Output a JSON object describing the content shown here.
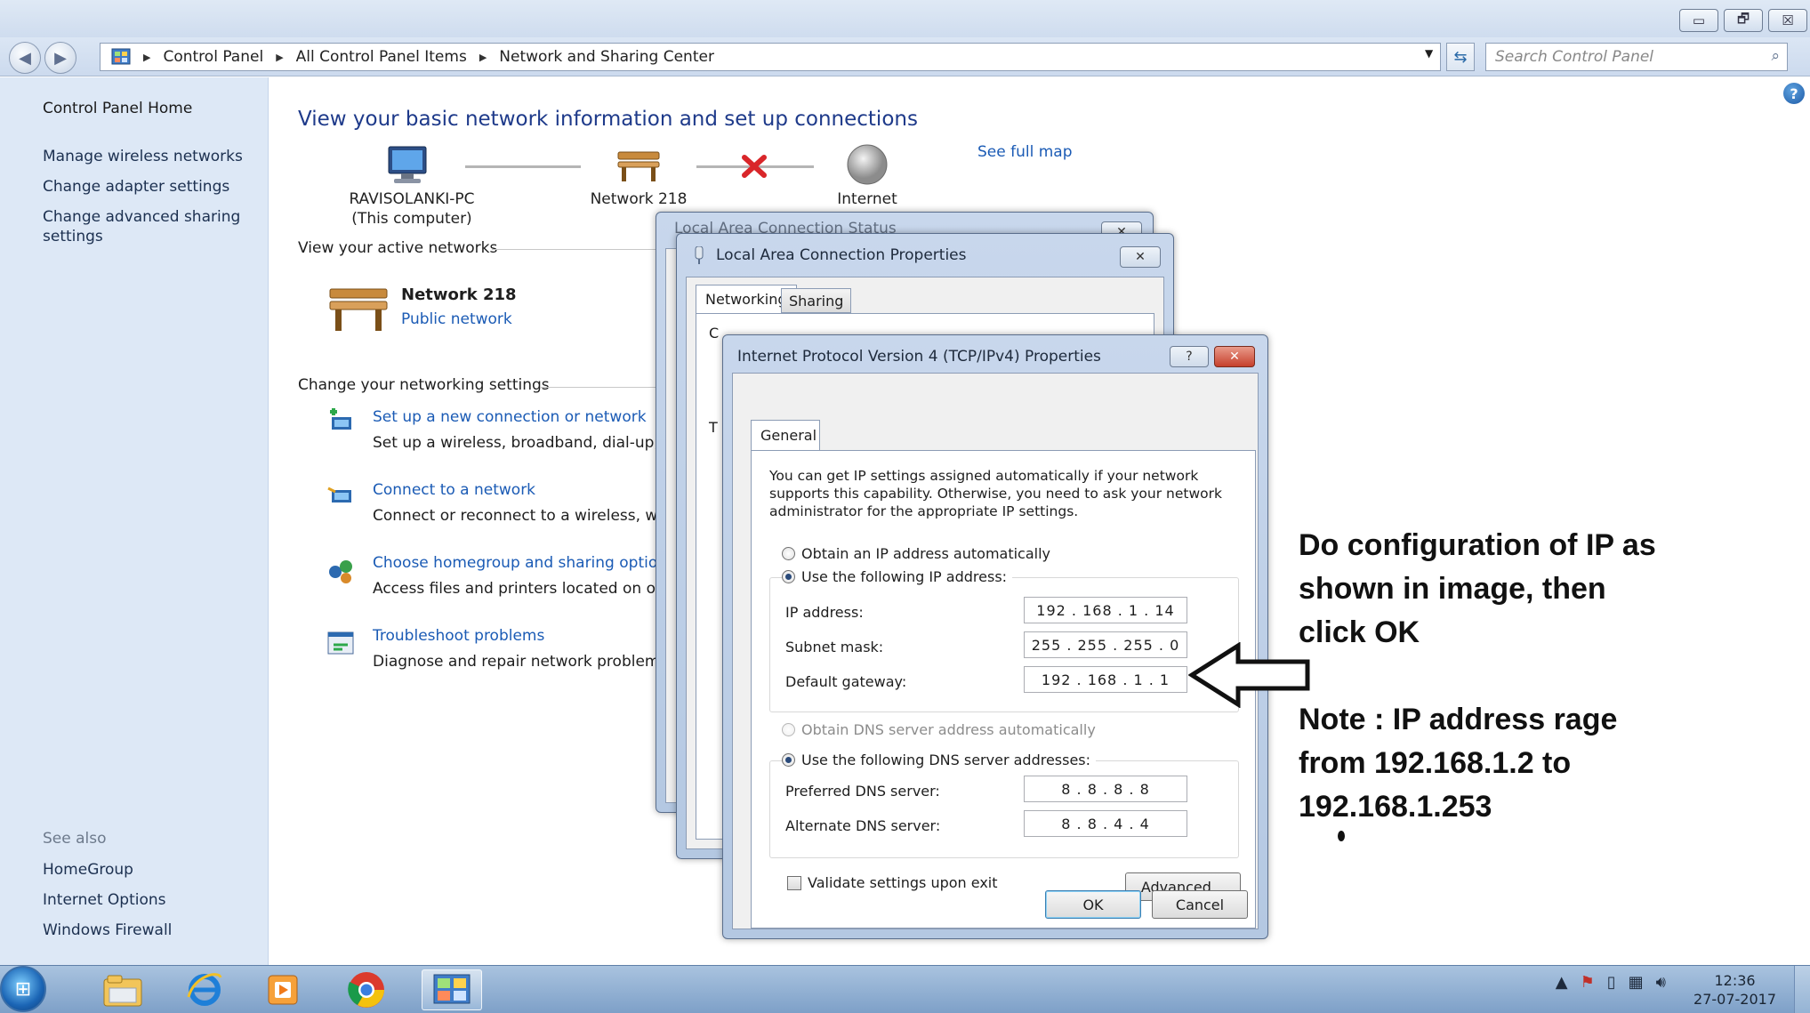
{
  "window": {
    "caption_buttons": [
      "▭",
      "🗗",
      "☒"
    ]
  },
  "address_bar": {
    "crumbs": [
      "Control Panel",
      "All Control Panel Items",
      "Network and Sharing Center"
    ],
    "search_placeholder": "Search Control Panel"
  },
  "left_pane": {
    "home": "Control Panel Home",
    "links": [
      "Manage wireless networks",
      "Change adapter settings",
      "Change advanced sharing",
      "settings"
    ],
    "see_also_heading": "See also",
    "see_also": [
      "HomeGroup",
      "Internet Options",
      "Windows Firewall"
    ]
  },
  "main": {
    "title": "View your basic network information and set up connections",
    "map": {
      "computer_name": "RAVISOLANKI-PC",
      "computer_sub": "(This computer)",
      "network": "Network  218",
      "internet": "Internet",
      "see_full_map": "See full map"
    },
    "active_networks_label": "View your active networks",
    "active_network_name": "Network  218",
    "active_network_type": "Public network",
    "change_settings_label": "Change your networking settings",
    "tasks": [
      {
        "link": "Set up a new connection or network",
        "desc": "Set up a wireless, broadband, dial-up, ad"
      },
      {
        "link": "Connect to a network",
        "desc": "Connect or reconnect to a wireless, wired"
      },
      {
        "link": "Choose homegroup and sharing options",
        "desc": "Access files and printers located on other"
      },
      {
        "link": "Troubleshoot problems",
        "desc": "Diagnose and repair network problems, o"
      }
    ]
  },
  "lan_status_dialog": {
    "title_fragment": "Local Area Connection Status"
  },
  "lan_props_dialog": {
    "title": "Local Area Connection Properties",
    "tabs": [
      "Networking",
      "Sharing"
    ],
    "fragment_c": "C",
    "fragment_t": "T"
  },
  "ipv4_dialog": {
    "title": "Internet Protocol Version 4 (TCP/IPv4) Properties",
    "help_glyph": "?",
    "tab": "General",
    "intro": "You can get IP settings assigned automatically if your network supports this capability. Otherwise, you need to ask your network administrator for the appropriate IP settings.",
    "obtain_ip_auto": "Obtain an IP address automatically",
    "use_following_ip": "Use the following IP address:",
    "ip_label": "IP address:",
    "ip_value": "192 . 168 .  1  . 14",
    "mask_label": "Subnet mask:",
    "mask_value": "255 . 255 . 255 .  0",
    "gateway_label": "Default gateway:",
    "gateway_value": "192 . 168 .  1  .  1",
    "obtain_dns_auto": "Obtain DNS server address automatically",
    "use_following_dns": "Use the following DNS server addresses:",
    "preferred_dns_label": "Preferred DNS server:",
    "preferred_dns_value": "8  .  8  .  8  .  8",
    "alternate_dns_label": "Alternate DNS server:",
    "alternate_dns_value": "8  .  8  .  4  .  4",
    "validate": "Validate settings upon exit",
    "advanced": "Advanced...",
    "ok": "OK",
    "cancel": "Cancel"
  },
  "annotation": {
    "instruction_lines": [
      "Do configuration of IP as",
      "shown in image, then",
      "click OK"
    ],
    "note_lines": [
      "Note : IP address rage",
      "from 192.168.1.2 to",
      "192.168.1.253"
    ]
  },
  "taskbar": {
    "time": "12:36",
    "date": "27-07-2017"
  },
  "colors": {
    "link_blue": "#1b5bb5",
    "title_blue": "#1e3a8a",
    "left_pane_bg": "#dde8f6",
    "error_red": "#d9262a"
  },
  "icons": [
    "back-icon",
    "forward-icon",
    "control-panel-icon",
    "refresh-icon",
    "search-icon",
    "help-icon",
    "computer-icon",
    "bench-network-icon",
    "red-x-icon",
    "globe-icon",
    "new-connection-icon",
    "connect-network-icon",
    "homegroup-icon",
    "troubleshoot-icon",
    "start-orb-icon",
    "explorer-icon",
    "ie-icon",
    "media-player-icon",
    "chrome-icon",
    "control-panel-taskbar-icon",
    "arrow-left-icon"
  ]
}
